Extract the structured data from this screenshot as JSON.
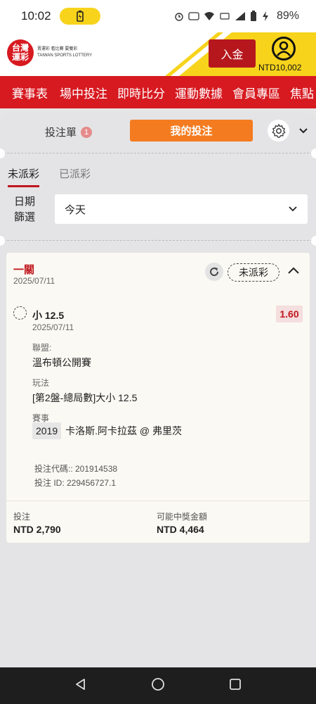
{
  "status_bar": {
    "time": "10:02",
    "battery_pct": "89%"
  },
  "header": {
    "logo_text": "台灣\n運彩",
    "logo_sub_line1": "賣運彩 看比賽 要雙彩",
    "logo_sub_line2": "TAIWAN SPORTS LOTTERY",
    "deposit_label": "入金",
    "balance": "NTD10,002"
  },
  "nav": {
    "items": [
      "賽事表",
      "場中投注",
      "即時比分",
      "運動數據",
      "會員專區",
      "焦點"
    ]
  },
  "tabs": {
    "betslip_label": "投注單",
    "betslip_count": "1",
    "mybets_label": "我的投注"
  },
  "subtabs": {
    "unsettled": "未派彩",
    "settled": "已派彩"
  },
  "filter": {
    "label_line1": "日期",
    "label_line2": "篩選",
    "value": "今天"
  },
  "bet": {
    "type": "一關",
    "date": "2025/07/11",
    "status": "未派彩",
    "selection": "小 12.5",
    "selection_date": "2025/07/11",
    "odds": "1.60",
    "league_label": "聯盟:",
    "league": "溫布頓公開賽",
    "market_label": "玩法",
    "market": "[第2盤-總局數]大小 12.5",
    "event_label": "賽事",
    "event_num": "2019",
    "event": "卡洛斯.阿卡拉茲 @ 弗里茨",
    "bet_code": "投注代碼:: 201914538",
    "bet_id": "投注 ID: 229456727.1",
    "stake_label": "投注",
    "stake": "NTD 2,790",
    "payout_label": "可能中獎金額",
    "payout": "NTD 4,464"
  },
  "colors": {
    "brand_red": "#d71920",
    "accent_orange": "#f47b20",
    "header_yellow": "#f7d31c"
  }
}
